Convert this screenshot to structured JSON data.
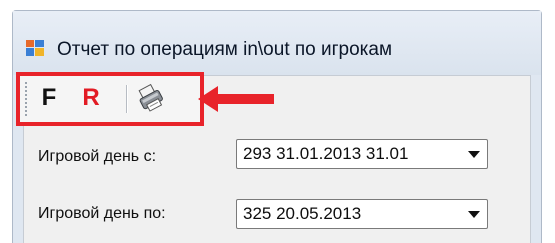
{
  "window": {
    "title": "Отчет по операциям  in\\out по игрокам"
  },
  "toolbar": {
    "f_label": "F",
    "r_label": "R",
    "print_icon": "printer-icon"
  },
  "form": {
    "from_label": "Игровой день с:",
    "from_value": "293 31.01.2013 31.01",
    "to_label": "Игровой день по:",
    "to_value": "325 20.05.2013"
  },
  "annotation": {
    "highlight_color": "#e8232a"
  }
}
